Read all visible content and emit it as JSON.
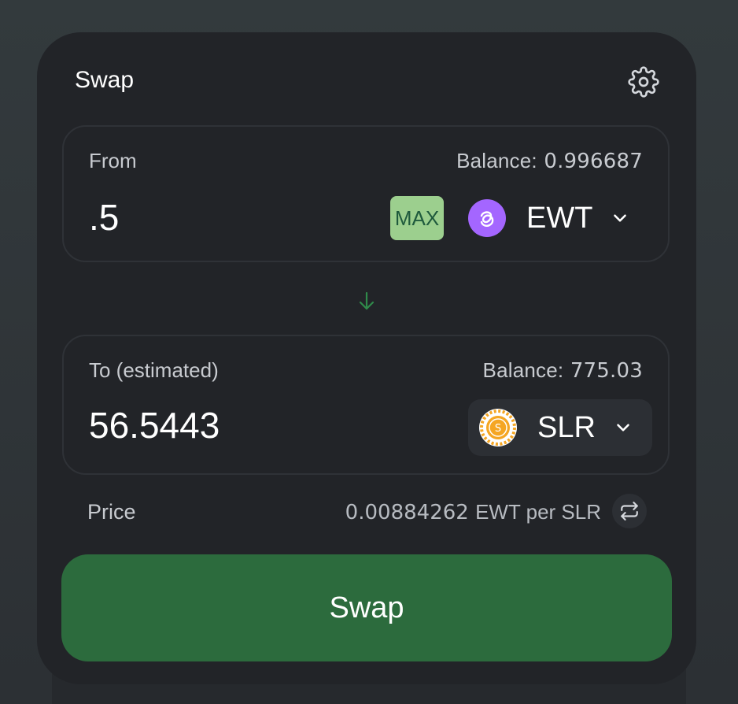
{
  "card": {
    "title": "Swap",
    "settings_icon": "gear-icon"
  },
  "from": {
    "label": "From",
    "balance_label": "Balance:",
    "balance_value": "0.996687",
    "amount": ".5",
    "max_label": "MAX",
    "token": {
      "symbol": "EWT",
      "icon": "energy-web-token-icon",
      "color": "#a466ff"
    }
  },
  "direction_icon": "arrow-down-icon",
  "to": {
    "label": "To (estimated)",
    "balance_label": "Balance:",
    "balance_value": "775.03",
    "amount": "56.5443",
    "token": {
      "symbol": "SLR",
      "icon": "solarcoin-token-icon",
      "color": "#f5a623"
    }
  },
  "price": {
    "label": "Price",
    "value": "0.00884262",
    "unit": "EWT per SLR",
    "flip_icon": "swap-arrows-icon"
  },
  "submit": {
    "label": "Swap",
    "color": "#2c6b3d"
  },
  "colors": {
    "accent_green": "#9ccf8e",
    "card_bg": "#222428"
  }
}
